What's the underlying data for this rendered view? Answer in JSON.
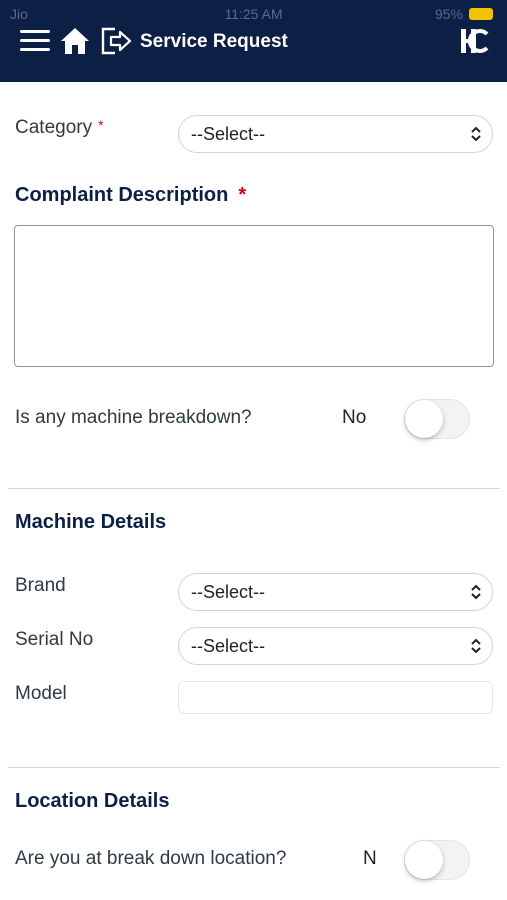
{
  "status_bar": {
    "carrier": "Jio",
    "time": "11:25 AM",
    "battery": "95%"
  },
  "nav": {
    "title": "Service Request",
    "logo_text": "HC"
  },
  "form": {
    "category_label": "Category",
    "required_mark": "*",
    "category_value": "--Select--",
    "complaint_title": "Complaint Description",
    "complaint_value": "",
    "breakdown_question": "Is any machine breakdown?",
    "breakdown_value": "No"
  },
  "machine_details": {
    "title": "Machine Details",
    "brand_label": "Brand",
    "brand_value": "--Select--",
    "serial_label": "Serial No",
    "serial_value": "--Select--",
    "model_label": "Model",
    "model_value": ""
  },
  "location_details": {
    "title": "Location Details",
    "question": "Are you at break down location?",
    "value_partial": "N"
  },
  "colors": {
    "header_bg": "#0c1f44",
    "required": "#d0021b",
    "section_title": "#0c1f44"
  }
}
